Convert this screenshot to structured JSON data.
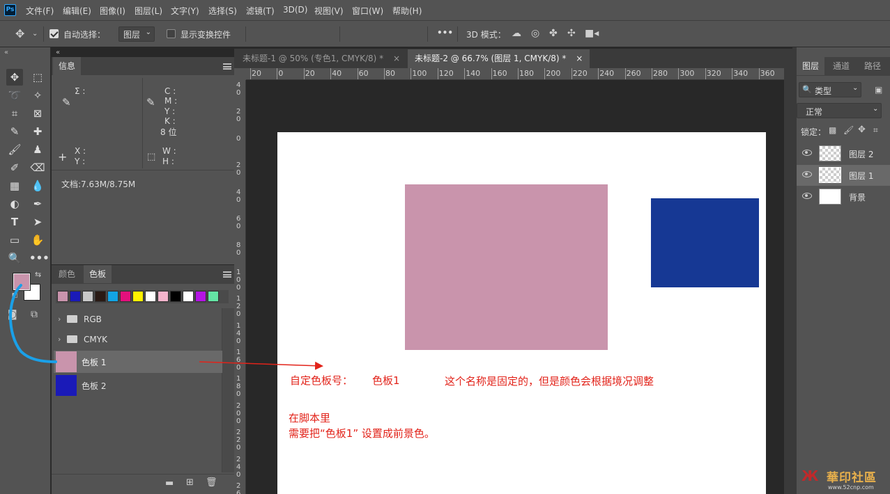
{
  "app": {
    "logo_text": "Ps"
  },
  "menubar": {
    "items": [
      "文件(F)",
      "编辑(E)",
      "图像(I)",
      "图层(L)",
      "文字(Y)",
      "选择(S)",
      "滤镜(T)",
      "3D(D)",
      "视图(V)",
      "窗口(W)",
      "帮助(H)"
    ]
  },
  "options": {
    "auto_select_label": "自动选择：",
    "auto_select_checked": true,
    "target_select": "图层",
    "show_transform_label": "显示变换控件",
    "show_transform_checked": false,
    "more_label": "•••",
    "mode3d_label": "3D 模式："
  },
  "info_panel": {
    "tab": "信息",
    "sigma_label": "Σ :",
    "cmyk_labels": [
      "C :",
      "M :",
      "Y :",
      "K :"
    ],
    "bit_label": "8 位",
    "xy_labels": [
      "X :",
      "Y :"
    ],
    "wh_labels": [
      "W :",
      "H :"
    ],
    "doc_info": "文档:7.63M/8.75M"
  },
  "swatches_panel": {
    "tabs": [
      "颜色",
      "色板"
    ],
    "active_tab": "色板",
    "quick_colors": [
      "#c994ac",
      "#1a1ab8",
      "#c8c8c8",
      "#2a1a14",
      "#12a4e4",
      "#e4107c",
      "#fff200",
      "#ffffff",
      "#f4b4cc",
      "#000000",
      "#ffffff",
      "#b414e4",
      "#64e4a4"
    ],
    "groups": [
      {
        "name": "RGB"
      },
      {
        "name": "CMYK"
      }
    ],
    "swatches": [
      {
        "name": "色板 1",
        "color": "#c994ac",
        "selected": true
      },
      {
        "name": "色板 2",
        "color": "#1a1ab8",
        "selected": false
      }
    ]
  },
  "document_tabs": [
    {
      "title": "未标题-1 @ 50% (专色1, CMYK/8) *",
      "close": "×",
      "active": false
    },
    {
      "title": "未标题-2 @ 66.7% (图层 1, CMYK/8) *",
      "close": "×",
      "active": true
    }
  ],
  "rulers": {
    "horizontal": [
      "20",
      "0",
      "20",
      "40",
      "60",
      "80",
      "100",
      "120",
      "140",
      "160",
      "180",
      "200",
      "220",
      "240",
      "260",
      "280",
      "300",
      "320",
      "340",
      "360"
    ],
    "vertical": [
      "40",
      "20",
      "0",
      "20",
      "40",
      "60",
      "80",
      "100",
      "120",
      "140",
      "160",
      "180",
      "200",
      "220",
      "240",
      "260"
    ]
  },
  "canvas": {
    "background": "#ffffff",
    "shapes": [
      {
        "name": "pink-rectangle",
        "color": "#c994ac"
      },
      {
        "name": "blue-rectangle",
        "color": "#163894"
      }
    ]
  },
  "annotations": {
    "swatch_label": "自定色板号：",
    "swatch_name": "色板1",
    "note": "这个名称是固定的，但是颜色会根据境况调整",
    "script_line1": "在脚本里",
    "script_line2": "需要把“色板1”   设置成前景色。",
    "color": "#e2231a"
  },
  "colors": {
    "foreground": "#c994ac",
    "background": "#ffffff",
    "arrow": "#1aa0e8"
  },
  "layers_panel": {
    "tabs": [
      "图层",
      "通道",
      "路径"
    ],
    "filter_label": "类型",
    "blend_mode": "正常",
    "lock_label": "锁定：",
    "layers": [
      {
        "name": "图层 2",
        "visible": true,
        "selected": false
      },
      {
        "name": "图层 1",
        "visible": true,
        "selected": true
      },
      {
        "name": "背景",
        "visible": true,
        "selected": false
      }
    ]
  },
  "watermark": {
    "text": "華印社區",
    "url": "www.52cnp.com"
  }
}
